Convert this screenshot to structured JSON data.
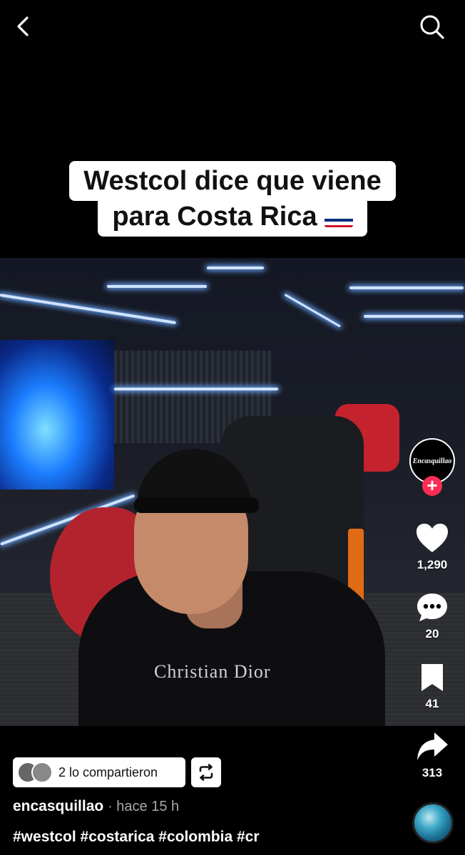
{
  "caption": {
    "line1": "Westcol dice que viene",
    "line2": "para Costa Rica"
  },
  "video": {
    "shirt_text": "Christian Dior"
  },
  "creator": {
    "avatar_text": "Encasquillao",
    "username": "encasquillao",
    "time": "· hace 15 h"
  },
  "actions": {
    "likes": "1,290",
    "comments": "20",
    "saves": "41",
    "shares": "313"
  },
  "shared_by": {
    "label": "2 lo compartieron"
  },
  "hashtags": "#westcol #costarica #colombia #cr",
  "colors": {
    "follow_red": "#fe2c55",
    "background": "#000000"
  }
}
